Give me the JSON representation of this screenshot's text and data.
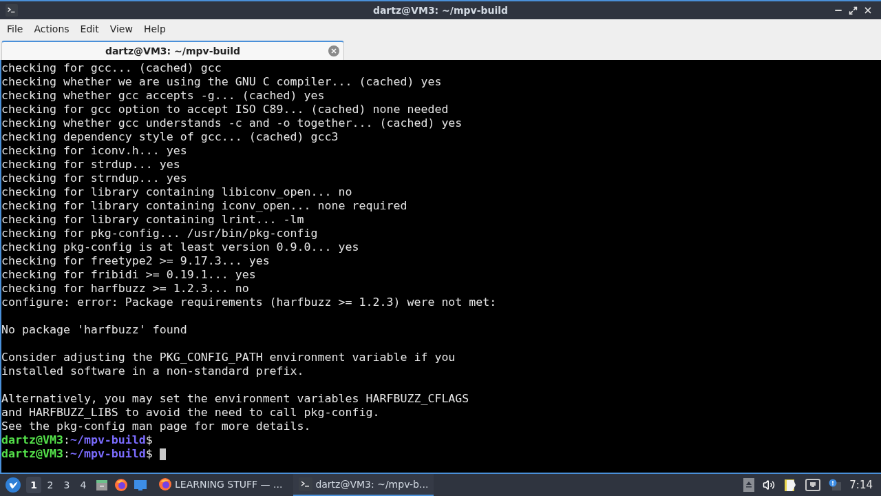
{
  "window": {
    "title": "dartz@VM3: ~/mpv-build"
  },
  "menu": [
    "File",
    "Actions",
    "Edit",
    "View",
    "Help"
  ],
  "tabs": [
    {
      "label": "dartz@VM3: ~/mpv-build",
      "selected": true
    }
  ],
  "terminal": {
    "lines": [
      {
        "kind": "output",
        "text": "checking for gcc... (cached) gcc"
      },
      {
        "kind": "output",
        "text": "checking whether we are using the GNU C compiler... (cached) yes"
      },
      {
        "kind": "output",
        "text": "checking whether gcc accepts -g... (cached) yes"
      },
      {
        "kind": "output",
        "text": "checking for gcc option to accept ISO C89... (cached) none needed"
      },
      {
        "kind": "output",
        "text": "checking whether gcc understands -c and -o together... (cached) yes"
      },
      {
        "kind": "output",
        "text": "checking dependency style of gcc... (cached) gcc3"
      },
      {
        "kind": "output",
        "text": "checking for iconv.h... yes"
      },
      {
        "kind": "output",
        "text": "checking for strdup... yes"
      },
      {
        "kind": "output",
        "text": "checking for strndup... yes"
      },
      {
        "kind": "output",
        "text": "checking for library containing libiconv_open... no"
      },
      {
        "kind": "output",
        "text": "checking for library containing iconv_open... none required"
      },
      {
        "kind": "output",
        "text": "checking for library containing lrint... -lm"
      },
      {
        "kind": "output",
        "text": "checking for pkg-config... /usr/bin/pkg-config"
      },
      {
        "kind": "output",
        "text": "checking pkg-config is at least version 0.9.0... yes"
      },
      {
        "kind": "output",
        "text": "checking for freetype2 >= 9.17.3... yes"
      },
      {
        "kind": "output",
        "text": "checking for fribidi >= 0.19.1... yes"
      },
      {
        "kind": "output",
        "text": "checking for harfbuzz >= 1.2.3... no"
      },
      {
        "kind": "output",
        "text": "configure: error: Package requirements (harfbuzz >= 1.2.3) were not met:"
      },
      {
        "kind": "blank"
      },
      {
        "kind": "output",
        "text": "No package 'harfbuzz' found"
      },
      {
        "kind": "blank"
      },
      {
        "kind": "output",
        "text": "Consider adjusting the PKG_CONFIG_PATH environment variable if you"
      },
      {
        "kind": "output",
        "text": "installed software in a non-standard prefix."
      },
      {
        "kind": "blank"
      },
      {
        "kind": "output",
        "text": "Alternatively, you may set the environment variables HARFBUZZ_CFLAGS"
      },
      {
        "kind": "output",
        "text": "and HARFBUZZ_LIBS to avoid the need to call pkg-config."
      },
      {
        "kind": "output",
        "text": "See the pkg-config man page for more details."
      },
      {
        "kind": "prompt",
        "user": "dartz@VM3",
        "sep": ":",
        "path": "~/mpv-build",
        "symbol": "$",
        "cursor": false
      },
      {
        "kind": "prompt",
        "user": "dartz@VM3",
        "sep": ":",
        "path": "~/mpv-build",
        "symbol": "$",
        "cursor": true
      }
    ]
  },
  "taskbar": {
    "workspaces": [
      {
        "label": "1",
        "selected": true
      },
      {
        "label": "2",
        "selected": false
      },
      {
        "label": "3",
        "selected": false
      },
      {
        "label": "4",
        "selected": false
      }
    ],
    "tasks": [
      {
        "label": "LEARNING STUFF — ...",
        "kind": "browser",
        "selected": false
      },
      {
        "label": "dartz@VM3: ~/mpv-b...",
        "kind": "terminal",
        "selected": true
      }
    ],
    "clock": "7:14"
  }
}
